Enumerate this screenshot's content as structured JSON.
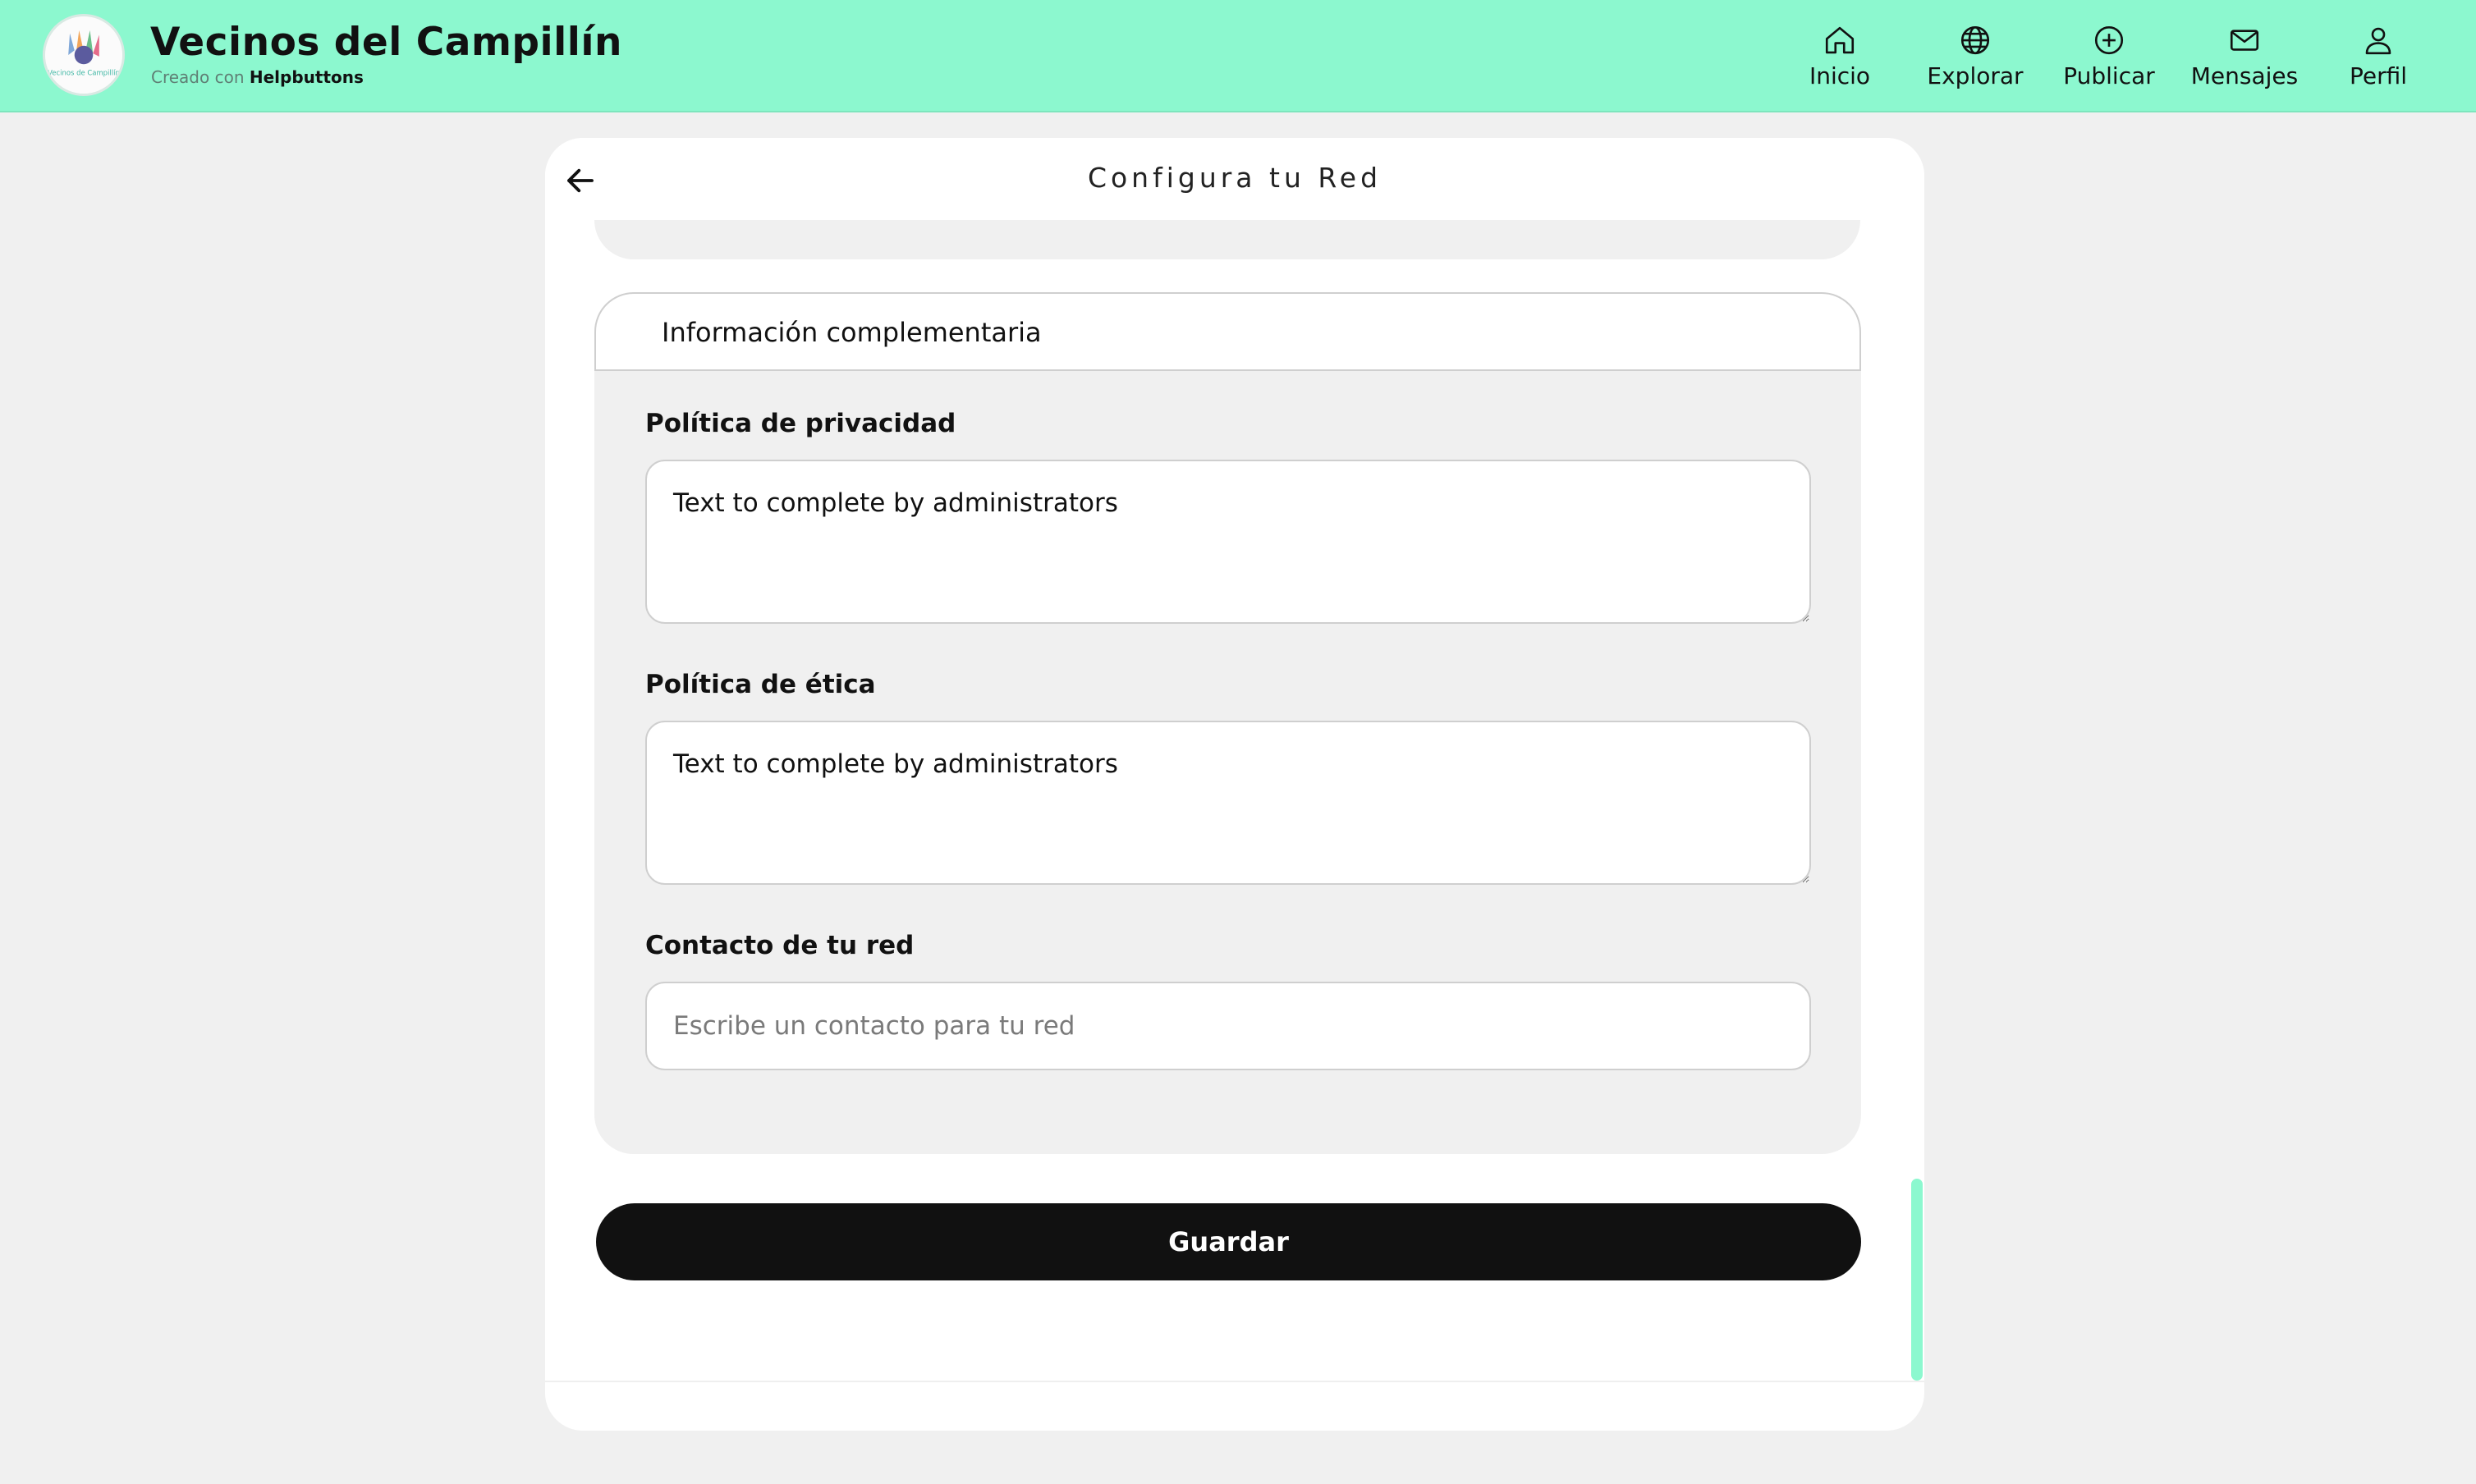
{
  "header": {
    "title": "Vecinos del Campillín",
    "subtitle_prefix": "Creado con",
    "subtitle_brand": "Helpbuttons",
    "logo_text": "Vecinos de Campillín",
    "nav": [
      {
        "label": "Inicio",
        "icon": "home-icon"
      },
      {
        "label": "Explorar",
        "icon": "globe-icon"
      },
      {
        "label": "Publicar",
        "icon": "plus-circle-icon"
      },
      {
        "label": "Mensajes",
        "icon": "mail-icon"
      },
      {
        "label": "Perfil",
        "icon": "user-icon"
      }
    ]
  },
  "page": {
    "title": "Configura tu Red",
    "back_icon": "arrow-left-icon"
  },
  "section": {
    "title": "Información complementaria",
    "fields": {
      "privacy": {
        "label": "Política de privacidad",
        "value": "Text to complete by administrators"
      },
      "ethics": {
        "label": "Política de ética",
        "value": "Text to complete by administrators"
      },
      "contact": {
        "label": "Contacto de tu red",
        "value": "",
        "placeholder": "Escribe un contacto para tu red"
      }
    }
  },
  "actions": {
    "save_label": "Guardar"
  },
  "colors": {
    "accent": "#8cf8cf",
    "button": "#111111",
    "panel": "#f0f0f0"
  }
}
